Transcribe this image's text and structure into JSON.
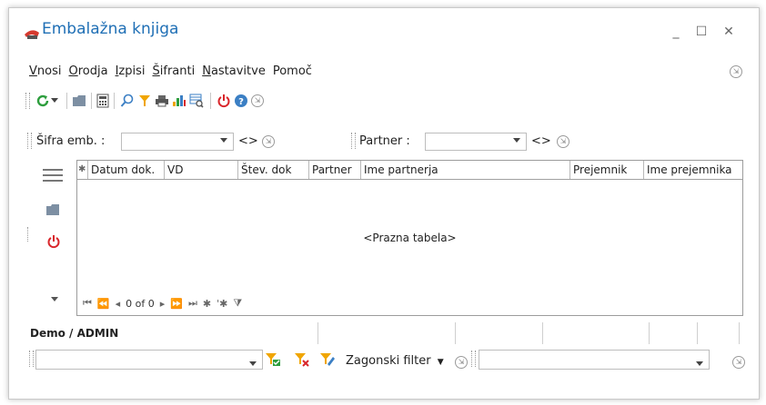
{
  "window": {
    "title": "Embalažna knjiga"
  },
  "menu": [
    {
      "key": "V",
      "rest": "nosi"
    },
    {
      "key": "O",
      "rest": "rodja"
    },
    {
      "key": "I",
      "rest": "zpisi"
    },
    {
      "key": "Š",
      "rest": "ifranti"
    },
    {
      "key": "N",
      "rest": "astavitve"
    },
    {
      "key": "",
      "rest": "Pomoč"
    }
  ],
  "toolbar": {
    "icons": [
      "refresh-icon",
      "dropdown-arrow-icon",
      "folder-icon",
      "calculator-icon",
      "search-icon",
      "filter-icon",
      "print-icon",
      "chart-icon",
      "grid-search-icon",
      "power-icon",
      "help-icon",
      "more-icon"
    ]
  },
  "filters": {
    "sifra_label": "Šifra emb. :",
    "sifra_value": "",
    "sifra_nav": "<>",
    "partner_label": "Partner :",
    "partner_value": "",
    "partner_nav": "<>"
  },
  "grid": {
    "columns": [
      "Datum dok.",
      "VD",
      "Štev. dok",
      "Partner",
      "Ime partnerja",
      "Prejemnik",
      "Ime prejemnika"
    ],
    "empty_text": "<Prazna tabela>",
    "nav_position": "0 of 0"
  },
  "status": {
    "user": "Demo / ADMIN"
  },
  "bottom": {
    "filter_value": "",
    "zagonski_label": "Zagonski filter",
    "right_value": ""
  },
  "colors": {
    "title": "#1f6fb5",
    "power": "#d9262b",
    "help": "#3b7fc4",
    "filter": "#f0a500",
    "refresh": "#2e9e3e"
  }
}
